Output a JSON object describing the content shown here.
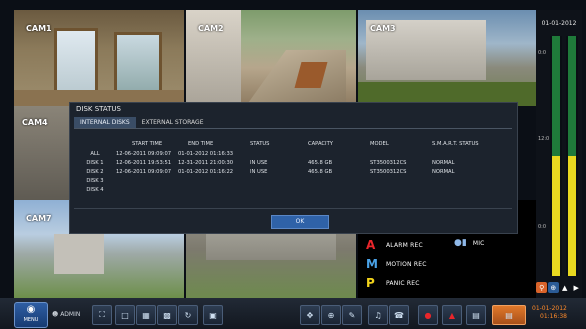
{
  "cameras": {
    "cam1": "CAM1",
    "cam2": "CAM2",
    "cam3": "CAM3",
    "cam4": "CAM4",
    "cam7": "CAM7"
  },
  "legend": {
    "alarm": {
      "letter": "A",
      "text": "ALARM REC",
      "color": "#e8262b"
    },
    "motion": {
      "letter": "M",
      "text": "MOTION REC",
      "color": "#4aa3e8"
    },
    "panic": {
      "letter": "P",
      "text": "PANIC REC",
      "color": "#f2d31b"
    },
    "mic": {
      "text": "MIC"
    }
  },
  "right_panel": {
    "date": "01-01-2012",
    "time_labels": [
      "0:0",
      "12:0",
      "0:0"
    ]
  },
  "dialog": {
    "title": "DISK STATUS",
    "tabs": [
      "INTERNAL DISKS",
      "EXTERNAL STORAGE"
    ],
    "active_tab": 0,
    "columns": [
      "START TIME",
      "END TIME",
      "STATUS",
      "CAPACITY",
      "MODEL",
      "S.M.A.R.T. STATUS"
    ],
    "rows": [
      {
        "label": "ALL",
        "start": "12-06-2011  09:09:07",
        "end": "01-01-2012  01:16:33",
        "status": "",
        "capacity": "",
        "model": "",
        "smart": ""
      },
      {
        "label": "DISK 1",
        "start": "12-06-2011  19:53:51",
        "end": "12-31-2011  21:00:30",
        "status": "IN USE",
        "capacity": "465.8 GB",
        "model": "ST3500312CS",
        "smart": "NORMAL"
      },
      {
        "label": "DISK 2",
        "start": "12-06-2011  09:09:07",
        "end": "01-01-2012  01:16:22",
        "status": "IN USE",
        "capacity": "465.8 GB",
        "model": "ST3500312CS",
        "smart": "NORMAL"
      },
      {
        "label": "DISK 3",
        "start": "",
        "end": "",
        "status": "",
        "capacity": "",
        "model": "",
        "smart": ""
      },
      {
        "label": "DISK 4",
        "start": "",
        "end": "",
        "status": "",
        "capacity": "",
        "model": "",
        "smart": ""
      }
    ],
    "ok_label": "OK"
  },
  "taskbar": {
    "menu_label": "MENU",
    "user_label": "ADMIN",
    "date": "01-01-2012",
    "time": "01:16:38"
  },
  "colors": {
    "accent": "#2f62a8",
    "date_orange": "#ff8a2a",
    "meter_green": "#2ea84a",
    "meter_yellow": "#e8d820"
  }
}
